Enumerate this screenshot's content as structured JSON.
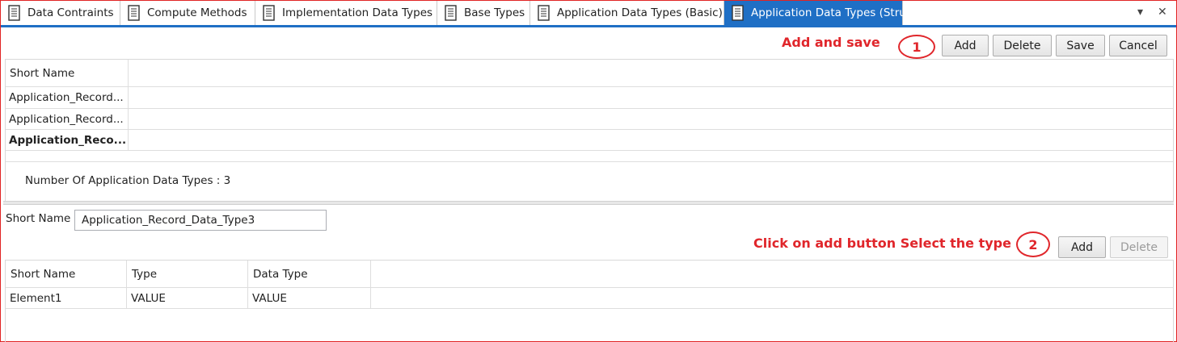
{
  "tabs": [
    {
      "label": "Data Contraints",
      "active": false
    },
    {
      "label": "Compute Methods",
      "active": false
    },
    {
      "label": "Implementation Data Types",
      "active": false
    },
    {
      "label": "Base Types",
      "active": false
    },
    {
      "label": "Application Data Types (Basic)",
      "active": false
    },
    {
      "label": "Application Data Types (Struct)",
      "active": true
    }
  ],
  "window_controls": {
    "dropdown": "▾",
    "close": "✕"
  },
  "toolbar": {
    "add_label": "Add",
    "delete_label": "Delete",
    "save_label": "Save",
    "cancel_label": "Cancel"
  },
  "annotations": {
    "step1_text": "Add and save",
    "step1_number": "1",
    "step2_text": "Click on add button Select the type",
    "step2_number": "2"
  },
  "types_grid": {
    "header": "Short Name",
    "rows": [
      "Application_Record...",
      "Application_Record...",
      "Application_Reco..."
    ],
    "selected_row": 2,
    "count_text": "Number Of Application Data Types : 3"
  },
  "detail": {
    "short_name_label": "Short Name",
    "short_name_value": "Application_Record_Data_Type3",
    "add_label": "Add",
    "delete_label": "Delete"
  },
  "elements_grid": {
    "columns": [
      "Short Name",
      "Type",
      "Data Type"
    ],
    "rows": [
      [
        "Element1",
        "VALUE",
        "VALUE"
      ]
    ]
  },
  "colors": {
    "accent": "#1f6fc5",
    "annotation": "#e0262b",
    "border": "#e02424"
  }
}
